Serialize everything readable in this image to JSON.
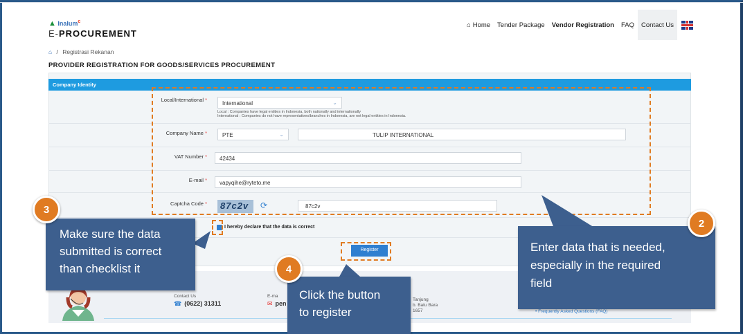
{
  "header": {
    "brand": "Inalum",
    "title_prefix": "E-",
    "title_main": "PROCUREMENT",
    "nav": [
      "Home",
      "Tender Package",
      "Vendor Registration",
      "FAQ",
      "Contact Us"
    ],
    "home_icon": "home-icon",
    "flag_icon": "uk-flag-icon"
  },
  "breadcrumb": {
    "home_icon": "home-icon",
    "separator": "/",
    "current": "Registrasi Rekanan"
  },
  "page_title": "PROVIDER REGISTRATION FOR GOODS/SERVICES PROCUREMENT",
  "section": {
    "title": "Company Identity"
  },
  "form": {
    "local_label": "Local/International",
    "local_value": "International",
    "hint_local": "Local : Companies have legal entities in Indonesia, both nationally and internationally",
    "hint_international": "International : Companies do not have representatives/branches in Indonesia, are not legal entities in Indonesia.",
    "company_label": "Company Name",
    "company_type": "PTE",
    "company_name": "TULIP INTERNATIONAL",
    "vat_label": "VAT Number",
    "vat_value": "42434",
    "email_label": "E-mail",
    "email_value": "vapyqihe@ryteto.me",
    "captcha_label": "Captcha Code",
    "captcha_image_text": "87c2v",
    "captcha_value": "87c2v",
    "required_mark": "*",
    "declaration": "I hereby declare that the data is correct",
    "register_button": "Register"
  },
  "footer": {
    "contact_label": "Contact Us",
    "contact_number": "(0622) 31311",
    "email_label": "E-ma",
    "email_value": "pen",
    "address_lines": [
      "Tanjung",
      "b. Batu Bara",
      "1657"
    ],
    "faq_link": "• Frequently Asked Questions (FAQ)"
  },
  "callouts": {
    "c2": {
      "number": "2",
      "lines": [
        "Enter data that is needed,",
        "especially in the required",
        "field"
      ]
    },
    "c3": {
      "number": "3",
      "lines": [
        "Make sure the data",
        "submitted is correct",
        "than checklist it"
      ]
    },
    "c4": {
      "number": "4",
      "lines": [
        "Click the button",
        "to register"
      ]
    }
  },
  "colors": {
    "accent": "#1e9be0",
    "callout": "#3d5f8e",
    "badge": "#e07b22",
    "button": "#2f7fd0"
  }
}
